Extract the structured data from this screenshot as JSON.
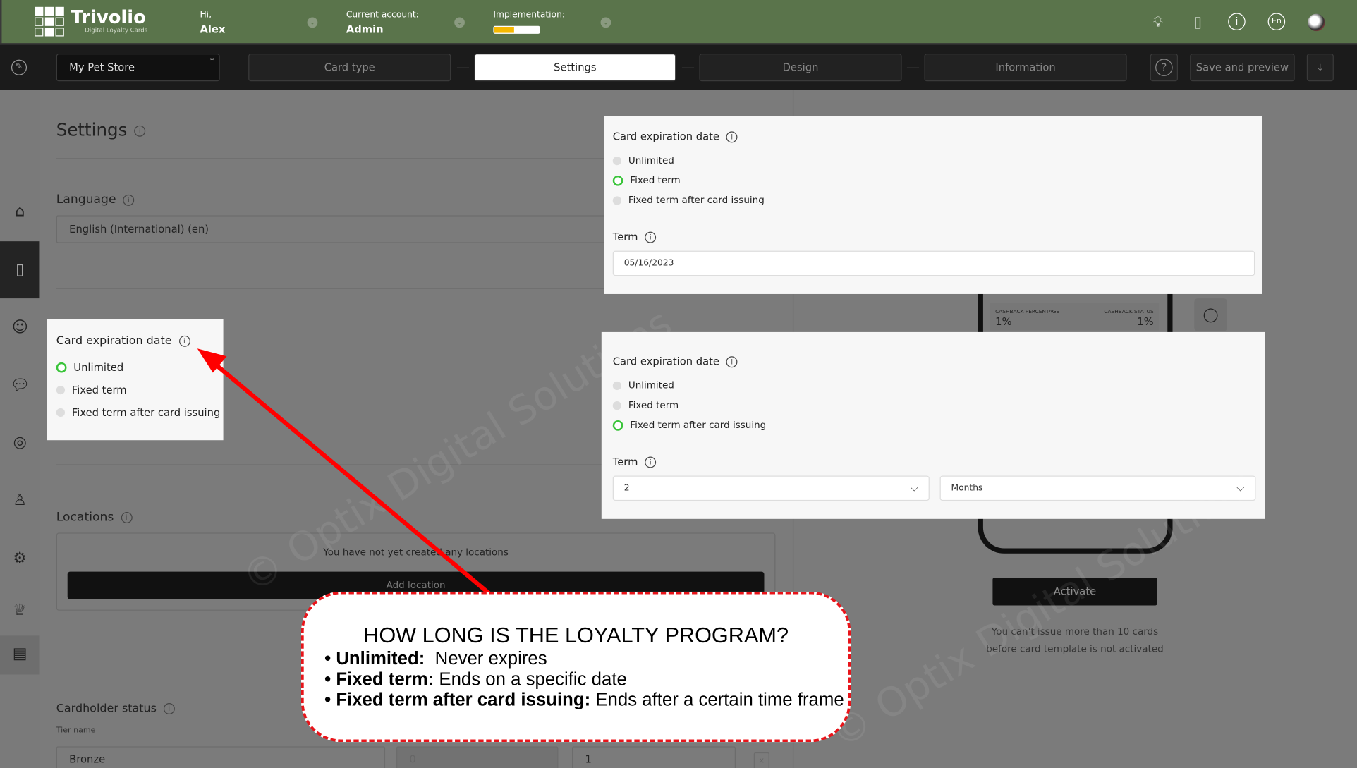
{
  "header": {
    "logo": "Trivolio",
    "logo_sub": "Digital Loyalty Cards",
    "greeting": "Hi,",
    "user": "Alex",
    "account_label": "Current account:",
    "account": "Admin",
    "implementation_label": "Implementation:",
    "implementation_progress": 0.45,
    "progress_color": "#f5b800",
    "brand_color": "#5a744b",
    "icons": [
      "lightbulb-icon",
      "phone-icon",
      "info-icon",
      "language-icon",
      "avatar"
    ],
    "language": "En"
  },
  "nav": {
    "store_name": "My Pet Store",
    "required_mark": "*",
    "steps": [
      "Card type",
      "Settings",
      "Design",
      "Information"
    ],
    "active_step": "Settings",
    "help": "?",
    "save_label": "Save and preview"
  },
  "sidebar": {
    "items": [
      "home-icon",
      "card-icon",
      "customers-icon",
      "messages-icon",
      "location-icon",
      "manager-icon",
      "settings-icon",
      "crown-icon",
      "store-icon"
    ],
    "active": "card-icon"
  },
  "main": {
    "title": "Settings",
    "language_label": "Language",
    "language_value": "English (International) (en)",
    "expiration": {
      "title": "Card expiration date",
      "options": [
        "Unlimited",
        "Fixed term",
        "Fixed term after card issuing"
      ],
      "selected": "Unlimited"
    },
    "locations": {
      "title": "Locations",
      "empty_text": "You have not yet created any locations",
      "add_label": "Add location"
    },
    "cardholder": {
      "title": "Cardholder status",
      "tier_label": "Tier name",
      "tier_value": "Bronze",
      "field2": "0",
      "field3": "1",
      "remove": "x"
    }
  },
  "popup_fixed": {
    "title": "Card expiration date",
    "options": [
      "Unlimited",
      "Fixed term",
      "Fixed term after card issuing"
    ],
    "selected": "Fixed term",
    "term_label": "Term",
    "term_value": "05/16/2023"
  },
  "popup_after": {
    "title": "Card expiration date",
    "options": [
      "Unlimited",
      "Fixed term",
      "Fixed term after card issuing"
    ],
    "selected": "Fixed term after card issuing",
    "term_label": "Term",
    "term_count": "2",
    "term_unit": "Months"
  },
  "preview": {
    "cashback_pct_label": "CASHBACK PERCENTAGE",
    "cashback_pct": "1%",
    "cashback_status_label": "CASHBACK STATUS",
    "cashback_status": "1%",
    "activate_label": "Activate",
    "notice": "You can't issue more than 10 cards before card template is not activated"
  },
  "callout": {
    "heading": "HOW LONG IS THE LOYALTY PROGRAM?",
    "items": [
      {
        "term": "Unlimited:",
        "desc": "Never expires"
      },
      {
        "term": "Fixed term:",
        "desc": "Ends on a specific date"
      },
      {
        "term": "Fixed term after card issuing:",
        "desc": "Ends after a certain time frame"
      }
    ],
    "border_color": "#e8141a"
  },
  "watermark": "© Optix Digital Solutions"
}
